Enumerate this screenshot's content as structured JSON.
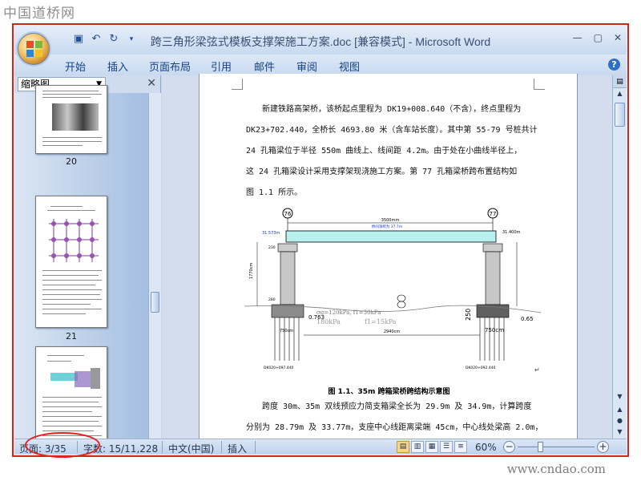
{
  "watermarks": {
    "top": "中国道桥网",
    "bottom": "www.cndao.com"
  },
  "window": {
    "title": "跨三角形梁弦式模板支撑架施工方案.doc [兼容模式] - Microsoft Word"
  },
  "ribbon": {
    "tabs": [
      "开始",
      "插入",
      "页面布局",
      "引用",
      "邮件",
      "审阅",
      "视图"
    ]
  },
  "nav_pane": {
    "selector": "缩略图",
    "thumbnails": [
      {
        "page": "20"
      },
      {
        "page": "21"
      }
    ]
  },
  "document": {
    "paragraph1": [
      "新建铁路高架桥，该桥起点里程为 DK19+008.640（不含），终点里程为",
      "DK23+702.440，全桥长 4693.80 米（含车站长度）。其中第 55-79 号桩共计",
      "24 孔箱梁位于半径 550m 曲线上、线间距 4.2m。由于处在小曲线半径上，",
      "这 24 孔箱梁设计采用支撑架现浇施工方案。第 77 孔箱梁桥跨布置结构如",
      "图 1.1 所示。"
    ],
    "figure": {
      "pier_left": "76",
      "pier_right": "77",
      "labels": {
        "span_top": "3500mm",
        "clear_span": "桥间净跨为 37.7m",
        "elev_left": "31.573m",
        "elev_right": "31.400m",
        "sigma": "σg=120kPa, f1=30kPa",
        "dim_2940": "2940cm",
        "dim_750": "750cm",
        "dim_280": "280",
        "dim_250": "250",
        "dim_1770": "1770cm",
        "dim_230": "230",
        "dim_0763": "0.763",
        "dim_065": "0.65",
        "sigma2": "180kPa",
        "sigma3": "f1=15kPa",
        "mileage_left": "DK020+097.440",
        "mileage_right": "DK020+092.440"
      },
      "caption": "图 1.1、35m 跨箱梁桥跨结构示意图"
    },
    "paragraph2": [
      "跨度 30m、35m 双线预应力简支箱梁全长为 29.9m 及 34.9m，计算跨度",
      "分别为 28.79m 及 33.77m，支座中心线距离梁端 45cm，中心线处梁高 2.0m，"
    ]
  },
  "status_bar": {
    "page": "页面: 3/35",
    "words": "字数: 15/11,228",
    "language": "中文(中国)",
    "mode": "插入",
    "zoom": "60%",
    "zoom_level": 0.6
  },
  "colors": {
    "annotation": "#e2211d",
    "ribbon": "#c7d9f0",
    "accent": "#15428b"
  },
  "icons": [
    "office-button-icon",
    "save-icon",
    "undo-icon",
    "redo-icon",
    "customize-qat-icon",
    "minimize-icon",
    "maximize-icon",
    "close-icon",
    "help-icon",
    "close-pane-icon",
    "scroll-up-icon",
    "scroll-down-icon",
    "prev-page-icon",
    "browse-object-icon",
    "next-page-icon",
    "print-layout-icon",
    "full-screen-reading-icon",
    "web-layout-icon",
    "outline-icon",
    "draft-icon",
    "zoom-out-icon",
    "zoom-in-icon"
  ]
}
